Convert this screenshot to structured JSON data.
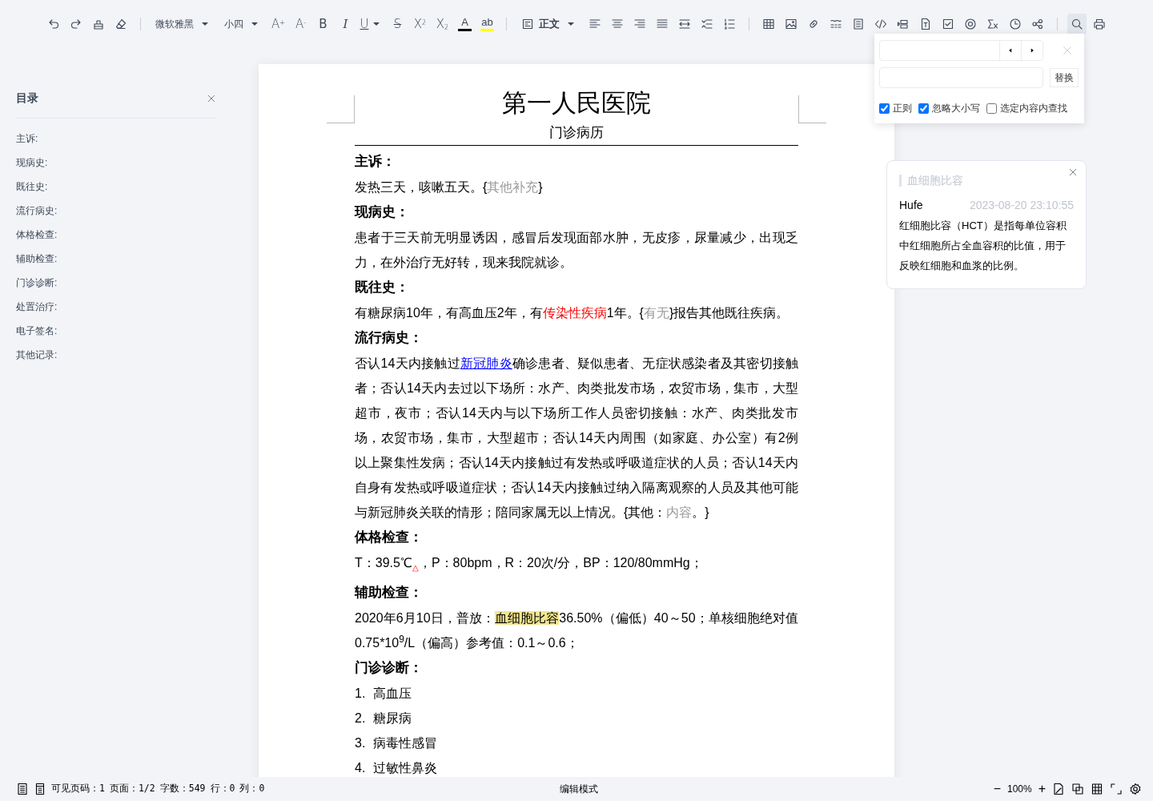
{
  "toolbar": {
    "font_family": "微软雅黑",
    "font_size": "小四",
    "format_buttons": [
      {
        "label": "A$^{+}$",
        "kind": "plain"
      },
      {
        "label": "A$^{-}$",
        "kind": "plain"
      },
      {
        "label": "B",
        "kind": "bold"
      },
      {
        "label": "I",
        "kind": "italic"
      },
      {
        "label": "U",
        "kind": "underline"
      },
      {
        "label": "S",
        "kind": "strike"
      },
      {
        "label": "X$^{2}$",
        "kind": "plain"
      },
      {
        "label": "X$_{2}$",
        "kind": "plain"
      }
    ],
    "font_color": {
      "label": "A",
      "color": "#000000"
    },
    "highlight": {
      "label": "ab",
      "color": "#ffff00"
    },
    "paragraph_style": "正文",
    "search_button": {
      "selected": true
    }
  },
  "search_panel": {
    "replace_button": "替换",
    "options": [
      {
        "label": "正则",
        "checked": true
      },
      {
        "label": "忽略大小写",
        "checked": true
      },
      {
        "label": "选定内容内查找",
        "checked": false
      }
    ]
  },
  "catalog": {
    "title": "目录",
    "items": [
      "主诉:",
      "现病史:",
      "既往史:",
      "流行病史:",
      "体格检查:",
      "辅助检查:",
      "门诊诊断:",
      "处置治疗:",
      "电子签名:",
      "其他记录:"
    ]
  },
  "document": {
    "title": "第一人民医院",
    "subtitle": "门诊病历",
    "blocks": [
      {
        "kind": "heading",
        "text": "主诉："
      },
      {
        "kind": "paragraph",
        "runs": [
          {
            "kind": "text",
            "text": "发热三天，咳嗽五天。{"
          },
          {
            "kind": "control",
            "text": "其他补充"
          },
          {
            "kind": "text",
            "text": "}"
          }
        ]
      },
      {
        "kind": "heading",
        "text": "现病史："
      },
      {
        "kind": "paragraph",
        "runs": [
          {
            "kind": "text",
            "text": "患者于三天前无明显诱因，感冒后发现面部水肿，无皮疹，尿量减少，出现乏力，在外治疗无好转，现来我院就诊。"
          }
        ]
      },
      {
        "kind": "heading",
        "text": "既往史："
      },
      {
        "kind": "paragraph",
        "runs": [
          {
            "kind": "text",
            "text": "有糖尿病10年，有高血压2年，有"
          },
          {
            "kind": "red",
            "text": "传染性疾病"
          },
          {
            "kind": "text",
            "text": "1年。{"
          },
          {
            "kind": "control",
            "text": "有无"
          },
          {
            "kind": "text",
            "text": "}报告其他既往疾病。"
          }
        ]
      },
      {
        "kind": "heading",
        "text": "流行病史："
      },
      {
        "kind": "paragraph",
        "runs": [
          {
            "kind": "text",
            "text": "否认14天内接触过"
          },
          {
            "kind": "link",
            "text": "新冠肺炎"
          },
          {
            "kind": "text",
            "text": "确诊患者、疑似患者、无症状感染者及其密切接触者；否认14天内去过以下场所：水产、肉类批发市场，农贸市场，集市，大型超市，夜市；否认14天内与以下场所工作人员密切接触：水产、肉类批发市场，农贸市场，集市，大型超市；否认14天内周围（如家庭、办公室）有2例以上聚集性发病；否认14天内接触过有发热或呼吸道症状的人员；否认14天内自身有发热或呼吸道症状；否认14天内接触过纳入隔离观察的人员及其他可能与新冠肺炎关联的情形；陪同家属无以上情况。{其他："
          },
          {
            "kind": "control",
            "text": "内容"
          },
          {
            "kind": "text",
            "text": "。}"
          }
        ]
      },
      {
        "kind": "heading",
        "text": "体格检查："
      },
      {
        "kind": "paragraph",
        "runs": [
          {
            "kind": "text",
            "text": "T：39.5℃"
          },
          {
            "kind": "mark",
            "text": "△"
          },
          {
            "kind": "text",
            "text": "，P：80bpm，R：20次/分，BP：120/80mmHg；"
          }
        ]
      },
      {
        "kind": "heading",
        "text": "辅助检查："
      },
      {
        "kind": "paragraph",
        "runs": [
          {
            "kind": "text",
            "text": "2020年6月10日，普放："
          },
          {
            "kind": "highlight",
            "text": "血细胞比容"
          },
          {
            "kind": "text",
            "text": "36.50%（偏低）40～50；单核细胞绝对值0.75*10$^{9}$/L（偏高）参考值：0.1～0.6；"
          }
        ]
      },
      {
        "kind": "heading",
        "text": "门诊诊断："
      },
      {
        "kind": "list_item",
        "number": "1.",
        "text": "高血压"
      },
      {
        "kind": "list_item",
        "number": "2.",
        "text": "糖尿病"
      },
      {
        "kind": "list_item",
        "number": "3.",
        "text": "病毒性感冒"
      },
      {
        "kind": "list_item",
        "number": "4.",
        "text": "过敏性鼻炎"
      }
    ]
  },
  "comment": {
    "title": "血细胞比容",
    "author": "Hufe",
    "time": "2023-08-20 23:10:55",
    "text": "红细胞比容（HCT）是指每单位容积中红细胞所占全血容积的比值，用于反映红细胞和血浆的比例。"
  },
  "status_bar": {
    "page_info": [
      "可见页码：1",
      "页面：1/2",
      "字数：549",
      "行：0",
      "列：0"
    ],
    "mode": "编辑模式",
    "zoom_out": "−",
    "zoom": "100%",
    "zoom_in": "+"
  }
}
